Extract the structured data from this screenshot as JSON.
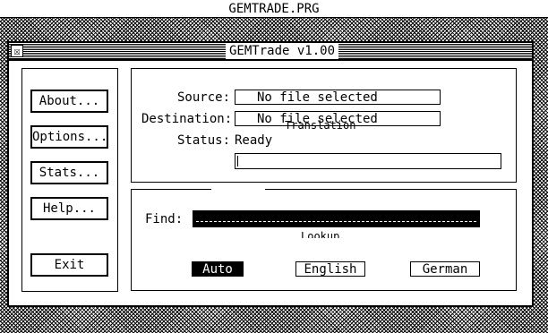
{
  "menubar": {
    "title": "GEMTRADE.PRG"
  },
  "window": {
    "title": "GEMTrade v1.00",
    "close_glyph": "☒"
  },
  "buttons": {
    "about": "About...",
    "options": "Options...",
    "stats": "Stats...",
    "help": "Help...",
    "exit": "Exit"
  },
  "translation": {
    "section_label": "Translation",
    "source_label": "Source:",
    "source_value": "No file selected",
    "destination_label": "Destination:",
    "destination_value": "No file selected",
    "status_label": "Status:",
    "status_value": "Ready",
    "progress": 0.0
  },
  "lookup": {
    "section_label": "Lookup",
    "find_label": "Find:",
    "find_value": "",
    "modes": [
      {
        "label": "Auto",
        "selected": true
      },
      {
        "label": "English",
        "selected": false
      },
      {
        "label": "German",
        "selected": false
      }
    ]
  }
}
